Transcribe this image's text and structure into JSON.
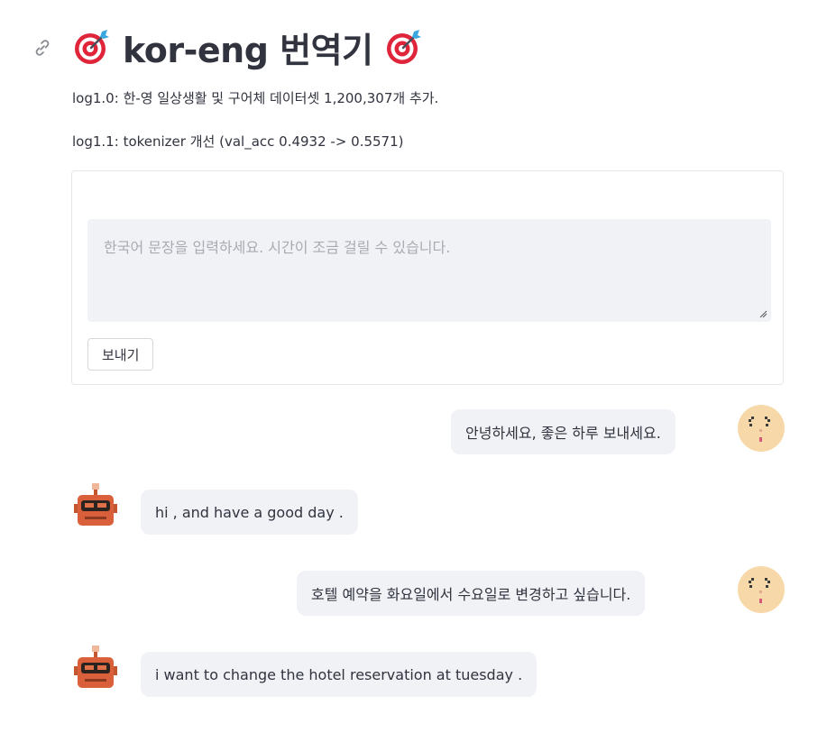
{
  "header": {
    "title_text": "kor-eng 번역기",
    "emoji_icon": "direct-hit-target-icon"
  },
  "changelog": {
    "log1_prefix": "log1.0:",
    "log1_text": "한-영 일상생활 및 구어체 데이터셋",
    "log1_count": "1,200,307",
    "log1_suffix": "개 추가.",
    "log2_prefix": "log1.1:",
    "log2_text": "tokenizer 개선",
    "log2_detail": "(val_acc 0.4932 -> 0.5571)"
  },
  "form": {
    "input_placeholder": "한국어 문장을 입력하세요. 시간이 조금 걸릴 수 있습니다.",
    "input_value": "",
    "send_label": "보내기"
  },
  "messages": [
    {
      "role": "user",
      "text": "안녕하세요, 좋은 하루 보내세요.",
      "avatar": "user-avatar-icon"
    },
    {
      "role": "bot",
      "text": "hi , and have a good day .",
      "avatar": "bot-avatar-icon"
    },
    {
      "role": "user",
      "text": "호텔 예약을 화요일에서 수요일로 변경하고 싶습니다.",
      "avatar": "user-avatar-icon"
    },
    {
      "role": "bot",
      "text": "i want to change the hotel reservation at tuesday .",
      "avatar": "bot-avatar-icon"
    }
  ],
  "colors": {
    "text": "#31333f",
    "bubble_bg": "#f0f2f6",
    "input_bg": "#f0f2f6",
    "border": "#e6e7ea",
    "target_red": "#e0243a",
    "dart_blue": "#3ba7e0",
    "user_skin": "#f7d8a8",
    "bot_orange": "#d9603a"
  }
}
